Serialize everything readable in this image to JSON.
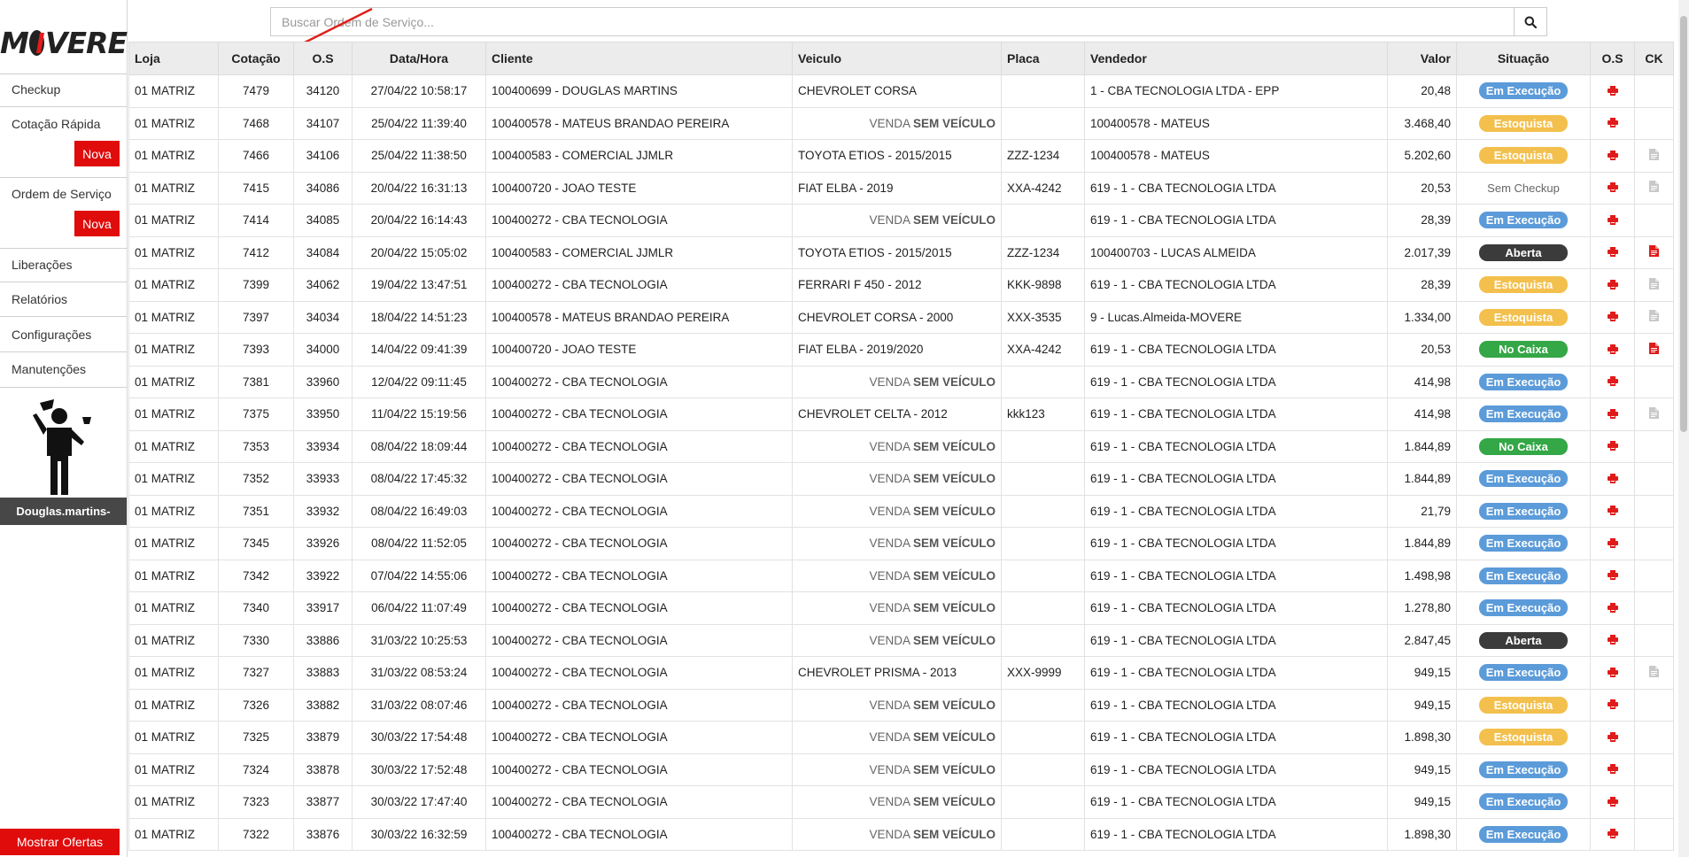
{
  "logo": {
    "left": "M",
    "right": "VERE"
  },
  "sidebar": {
    "items": [
      {
        "label": "Checkup"
      },
      {
        "label": "Cotação Rápida",
        "button": "Nova"
      },
      {
        "label": "Ordem de Serviço",
        "button": "Nova"
      },
      {
        "label": "Liberações"
      },
      {
        "label": "Relatórios"
      },
      {
        "label": "Configurações"
      },
      {
        "label": "Manutenções"
      }
    ],
    "username": "Douglas.martins-",
    "offers_button": "Mostrar Ofertas"
  },
  "search": {
    "placeholder": "Buscar Ordem de Serviço..."
  },
  "table": {
    "columns": [
      "Loja",
      "Cotação",
      "O.S",
      "Data/Hora",
      "Cliente",
      "Veiculo",
      "Placa",
      "Vendedor",
      "Valor",
      "Situação",
      "O.S",
      "CK"
    ],
    "no_vehicle": {
      "prefix": "VENDA",
      "bold": "SEM VEÍCULO"
    },
    "status_colors": {
      "Em Execução": "#5b9bd9",
      "Estoquista": "#f3c04d",
      "Aberta": "#3b3b3b",
      "No Caixa": "#34a746"
    },
    "rows": [
      {
        "loja": "01 MATRIZ",
        "cotacao": "7479",
        "os": "34120",
        "data": "27/04/22 10:58:17",
        "cliente": "100400699 - DOUGLAS MARTINS",
        "veiculo": "CHEVROLET CORSA",
        "placa": "",
        "vendedor": "1 - CBA TECNOLOGIA LTDA - EPP",
        "valor": "20,48",
        "situacao": "Em Execução",
        "ck": "none"
      },
      {
        "loja": "01 MATRIZ",
        "cotacao": "7468",
        "os": "34107",
        "data": "25/04/22 11:39:40",
        "cliente": "100400578 - MATEUS BRANDAO PEREIRA",
        "veiculo": null,
        "placa": "",
        "vendedor": "100400578 - MATEUS",
        "valor": "3.468,40",
        "situacao": "Estoquista",
        "ck": "none"
      },
      {
        "loja": "01 MATRIZ",
        "cotacao": "7466",
        "os": "34106",
        "data": "25/04/22 11:38:50",
        "cliente": "100400583 - COMERCIAL JJMLR",
        "veiculo": "TOYOTA ETIOS - 2015/2015",
        "placa": "ZZZ-1234",
        "vendedor": "100400578 - MATEUS",
        "valor": "5.202,60",
        "situacao": "Estoquista",
        "ck": "gray"
      },
      {
        "loja": "01 MATRIZ",
        "cotacao": "7415",
        "os": "34086",
        "data": "20/04/22 16:31:13",
        "cliente": "100400720 - JOAO TESTE",
        "veiculo": "FIAT ELBA - 2019",
        "placa": "XXA-4242",
        "vendedor": "619 - 1 - CBA TECNOLOGIA LTDA",
        "valor": "20,53",
        "situacao": "Sem Checkup",
        "ck": "gray"
      },
      {
        "loja": "01 MATRIZ",
        "cotacao": "7414",
        "os": "34085",
        "data": "20/04/22 16:14:43",
        "cliente": "100400272 - CBA TECNOLOGIA",
        "veiculo": null,
        "placa": "",
        "vendedor": "619 - 1 - CBA TECNOLOGIA LTDA",
        "valor": "28,39",
        "situacao": "Em Execução",
        "ck": "none"
      },
      {
        "loja": "01 MATRIZ",
        "cotacao": "7412",
        "os": "34084",
        "data": "20/04/22 15:05:02",
        "cliente": "100400583 - COMERCIAL JJMLR",
        "veiculo": "TOYOTA ETIOS - 2015/2015",
        "placa": "ZZZ-1234",
        "vendedor": "100400703 - LUCAS ALMEIDA",
        "valor": "2.017,39",
        "situacao": "Aberta",
        "ck": "red"
      },
      {
        "loja": "01 MATRIZ",
        "cotacao": "7399",
        "os": "34062",
        "data": "19/04/22 13:47:51",
        "cliente": "100400272 - CBA TECNOLOGIA",
        "veiculo": "FERRARI F 450 - 2012",
        "placa": "KKK-9898",
        "vendedor": "619 - 1 - CBA TECNOLOGIA LTDA",
        "valor": "28,39",
        "situacao": "Estoquista",
        "ck": "gray"
      },
      {
        "loja": "01 MATRIZ",
        "cotacao": "7397",
        "os": "34034",
        "data": "18/04/22 14:51:23",
        "cliente": "100400578 - MATEUS BRANDAO PEREIRA",
        "veiculo": "CHEVROLET CORSA - 2000",
        "placa": "XXX-3535",
        "vendedor": "9 - Lucas.Almeida-MOVERE",
        "valor": "1.334,00",
        "situacao": "Estoquista",
        "ck": "gray"
      },
      {
        "loja": "01 MATRIZ",
        "cotacao": "7393",
        "os": "34000",
        "data": "14/04/22 09:41:39",
        "cliente": "100400720 - JOAO TESTE",
        "veiculo": "FIAT ELBA - 2019/2020",
        "placa": "XXA-4242",
        "vendedor": "619 - 1 - CBA TECNOLOGIA LTDA",
        "valor": "20,53",
        "situacao": "No Caixa",
        "ck": "red"
      },
      {
        "loja": "01 MATRIZ",
        "cotacao": "7381",
        "os": "33960",
        "data": "12/04/22 09:11:45",
        "cliente": "100400272 - CBA TECNOLOGIA",
        "veiculo": null,
        "placa": "",
        "vendedor": "619 - 1 - CBA TECNOLOGIA LTDA",
        "valor": "414,98",
        "situacao": "Em Execução",
        "ck": "none"
      },
      {
        "loja": "01 MATRIZ",
        "cotacao": "7375",
        "os": "33950",
        "data": "11/04/22 15:19:56",
        "cliente": "100400272 - CBA TECNOLOGIA",
        "veiculo": "CHEVROLET CELTA - 2012",
        "placa": "kkk123",
        "vendedor": "619 - 1 - CBA TECNOLOGIA LTDA",
        "valor": "414,98",
        "situacao": "Em Execução",
        "ck": "gray"
      },
      {
        "loja": "01 MATRIZ",
        "cotacao": "7353",
        "os": "33934",
        "data": "08/04/22 18:09:44",
        "cliente": "100400272 - CBA TECNOLOGIA",
        "veiculo": null,
        "placa": "",
        "vendedor": "619 - 1 - CBA TECNOLOGIA LTDA",
        "valor": "1.844,89",
        "situacao": "No Caixa",
        "ck": "none"
      },
      {
        "loja": "01 MATRIZ",
        "cotacao": "7352",
        "os": "33933",
        "data": "08/04/22 17:45:32",
        "cliente": "100400272 - CBA TECNOLOGIA",
        "veiculo": null,
        "placa": "",
        "vendedor": "619 - 1 - CBA TECNOLOGIA LTDA",
        "valor": "1.844,89",
        "situacao": "Em Execução",
        "ck": "none"
      },
      {
        "loja": "01 MATRIZ",
        "cotacao": "7351",
        "os": "33932",
        "data": "08/04/22 16:49:03",
        "cliente": "100400272 - CBA TECNOLOGIA",
        "veiculo": null,
        "placa": "",
        "vendedor": "619 - 1 - CBA TECNOLOGIA LTDA",
        "valor": "21,79",
        "situacao": "Em Execução",
        "ck": "none"
      },
      {
        "loja": "01 MATRIZ",
        "cotacao": "7345",
        "os": "33926",
        "data": "08/04/22 11:52:05",
        "cliente": "100400272 - CBA TECNOLOGIA",
        "veiculo": null,
        "placa": "",
        "vendedor": "619 - 1 - CBA TECNOLOGIA LTDA",
        "valor": "1.844,89",
        "situacao": "Em Execução",
        "ck": "none"
      },
      {
        "loja": "01 MATRIZ",
        "cotacao": "7342",
        "os": "33922",
        "data": "07/04/22 14:55:06",
        "cliente": "100400272 - CBA TECNOLOGIA",
        "veiculo": null,
        "placa": "",
        "vendedor": "619 - 1 - CBA TECNOLOGIA LTDA",
        "valor": "1.498,98",
        "situacao": "Em Execução",
        "ck": "none"
      },
      {
        "loja": "01 MATRIZ",
        "cotacao": "7340",
        "os": "33917",
        "data": "06/04/22 11:07:49",
        "cliente": "100400272 - CBA TECNOLOGIA",
        "veiculo": null,
        "placa": "",
        "vendedor": "619 - 1 - CBA TECNOLOGIA LTDA",
        "valor": "1.278,80",
        "situacao": "Em Execução",
        "ck": "none"
      },
      {
        "loja": "01 MATRIZ",
        "cotacao": "7330",
        "os": "33886",
        "data": "31/03/22 10:25:53",
        "cliente": "100400272 - CBA TECNOLOGIA",
        "veiculo": null,
        "placa": "",
        "vendedor": "619 - 1 - CBA TECNOLOGIA LTDA",
        "valor": "2.847,45",
        "situacao": "Aberta",
        "ck": "none"
      },
      {
        "loja": "01 MATRIZ",
        "cotacao": "7327",
        "os": "33883",
        "data": "31/03/22 08:53:24",
        "cliente": "100400272 - CBA TECNOLOGIA",
        "veiculo": "CHEVROLET PRISMA - 2013",
        "placa": "XXX-9999",
        "vendedor": "619 - 1 - CBA TECNOLOGIA LTDA",
        "valor": "949,15",
        "situacao": "Em Execução",
        "ck": "gray"
      },
      {
        "loja": "01 MATRIZ",
        "cotacao": "7326",
        "os": "33882",
        "data": "31/03/22 08:07:46",
        "cliente": "100400272 - CBA TECNOLOGIA",
        "veiculo": null,
        "placa": "",
        "vendedor": "619 - 1 - CBA TECNOLOGIA LTDA",
        "valor": "949,15",
        "situacao": "Estoquista",
        "ck": "none"
      },
      {
        "loja": "01 MATRIZ",
        "cotacao": "7325",
        "os": "33879",
        "data": "30/03/22 17:54:48",
        "cliente": "100400272 - CBA TECNOLOGIA",
        "veiculo": null,
        "placa": "",
        "vendedor": "619 - 1 - CBA TECNOLOGIA LTDA",
        "valor": "1.898,30",
        "situacao": "Estoquista",
        "ck": "none"
      },
      {
        "loja": "01 MATRIZ",
        "cotacao": "7324",
        "os": "33878",
        "data": "30/03/22 17:52:48",
        "cliente": "100400272 - CBA TECNOLOGIA",
        "veiculo": null,
        "placa": "",
        "vendedor": "619 - 1 - CBA TECNOLOGIA LTDA",
        "valor": "949,15",
        "situacao": "Em Execução",
        "ck": "none"
      },
      {
        "loja": "01 MATRIZ",
        "cotacao": "7323",
        "os": "33877",
        "data": "30/03/22 17:47:40",
        "cliente": "100400272 - CBA TECNOLOGIA",
        "veiculo": null,
        "placa": "",
        "vendedor": "619 - 1 - CBA TECNOLOGIA LTDA",
        "valor": "949,15",
        "situacao": "Em Execução",
        "ck": "none"
      },
      {
        "loja": "01 MATRIZ",
        "cotacao": "7322",
        "os": "33876",
        "data": "30/03/22 16:32:59",
        "cliente": "100400272 - CBA TECNOLOGIA",
        "veiculo": null,
        "placa": "",
        "vendedor": "619 - 1 - CBA TECNOLOGIA LTDA",
        "valor": "1.898,30",
        "situacao": "Em Execução",
        "ck": "none"
      }
    ]
  }
}
